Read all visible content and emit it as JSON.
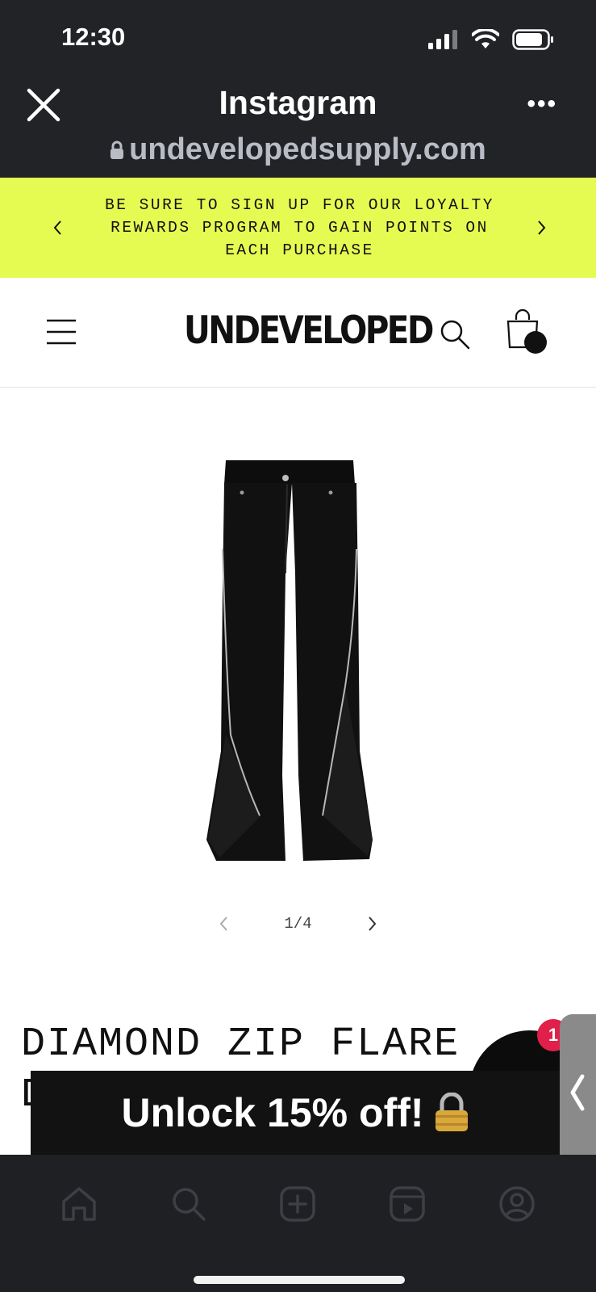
{
  "status_bar": {
    "time": "12:30",
    "icons": [
      "signal-icon",
      "wifi-icon",
      "battery-icon"
    ]
  },
  "browser": {
    "title": "Instagram",
    "url": "undevelopedsupply.com",
    "close_icon": "close-icon",
    "more_icon": "more-icon",
    "lock_icon": "lock-icon"
  },
  "promo": {
    "text": "BE SURE TO SIGN UP FOR OUR LOYALTY REWARDS PROGRAM TO GAIN POINTS ON EACH PURCHASE",
    "background": "#e5fb52"
  },
  "store": {
    "logo": "UNDEVELOPED",
    "menu_icon": "menu-icon",
    "search_icon": "search-icon",
    "bag_icon": "shopping-bag-icon"
  },
  "gallery": {
    "current": 1,
    "total": 4,
    "counter": "1/4"
  },
  "product": {
    "title": "DIAMOND ZIP FLARE",
    "title_line2": "D"
  },
  "chat": {
    "badge": "1"
  },
  "unlock": {
    "text": "Unlock 15% off!",
    "emoji": "🔒"
  },
  "ig_nav": {
    "items": [
      "home-icon",
      "search-icon",
      "create-icon",
      "reels-icon",
      "profile-icon"
    ]
  }
}
